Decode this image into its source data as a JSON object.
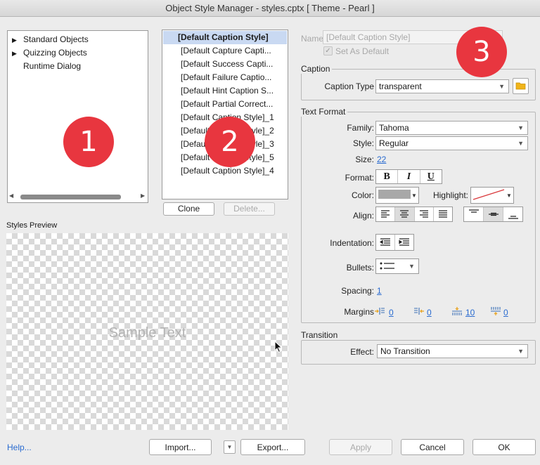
{
  "window": {
    "title": "Object Style Manager - styles.cptx [ Theme - Pearl ]"
  },
  "tree": {
    "items": [
      {
        "label": "Standard Objects",
        "expandable": true
      },
      {
        "label": "Quizzing Objects",
        "expandable": true
      },
      {
        "label": "Runtime Dialog",
        "expandable": false
      }
    ]
  },
  "styles_list": {
    "items": [
      "[Default Caption Style]",
      "[Default Capture Capti...",
      "[Default Success Capti...",
      "[Default Failure Captio...",
      "[Default Hint Caption S...",
      "[Default Partial Correct...",
      "[Default Caption Style]_1",
      "[Default Caption Style]_2",
      "[Default Caption Style]_3",
      "[Default Caption Style]_5",
      "[Default Caption Style]_4"
    ],
    "clone_label": "Clone",
    "delete_label": "Delete..."
  },
  "preview": {
    "label": "Styles Preview",
    "sample_text": "Sample Text"
  },
  "name_section": {
    "name_label": "Name",
    "name_value": "[Default Caption Style]",
    "set_default_label": "Set As Default"
  },
  "caption": {
    "group_label": "Caption",
    "type_label": "Caption Type",
    "type_value": "transparent"
  },
  "text_format": {
    "group_label": "Text Format",
    "family_label": "Family:",
    "family_value": "Tahoma",
    "style_label": "Style:",
    "style_value": "Regular",
    "size_label": "Size:",
    "size_value": "22",
    "format_label": "Format:",
    "bold": "B",
    "italic": "I",
    "underline": "U",
    "color_label": "Color:",
    "color_value": "#a8a8a8",
    "highlight_label": "Highlight:",
    "align_label": "Align:",
    "indentation_label": "Indentation:",
    "bullets_label": "Bullets:",
    "spacing_label": "Spacing:",
    "spacing_value": "1",
    "margins_label": "Margins",
    "margin_left": "0",
    "margin_right": "0",
    "margin_top": "10",
    "margin_bottom": "0"
  },
  "transition": {
    "group_label": "Transition",
    "effect_label": "Effect:",
    "effect_value": "No Transition"
  },
  "footer": {
    "help_label": "Help...",
    "import_label": "Import...",
    "export_label": "Export...",
    "apply_label": "Apply",
    "cancel_label": "Cancel",
    "ok_label": "OK"
  },
  "badges": {
    "one": "1",
    "two": "2",
    "three": "3"
  },
  "colors": {
    "selection": "#c9d9f2",
    "badge": "#e8363f",
    "link": "#2a6bd0",
    "folder": "#f0b419"
  }
}
